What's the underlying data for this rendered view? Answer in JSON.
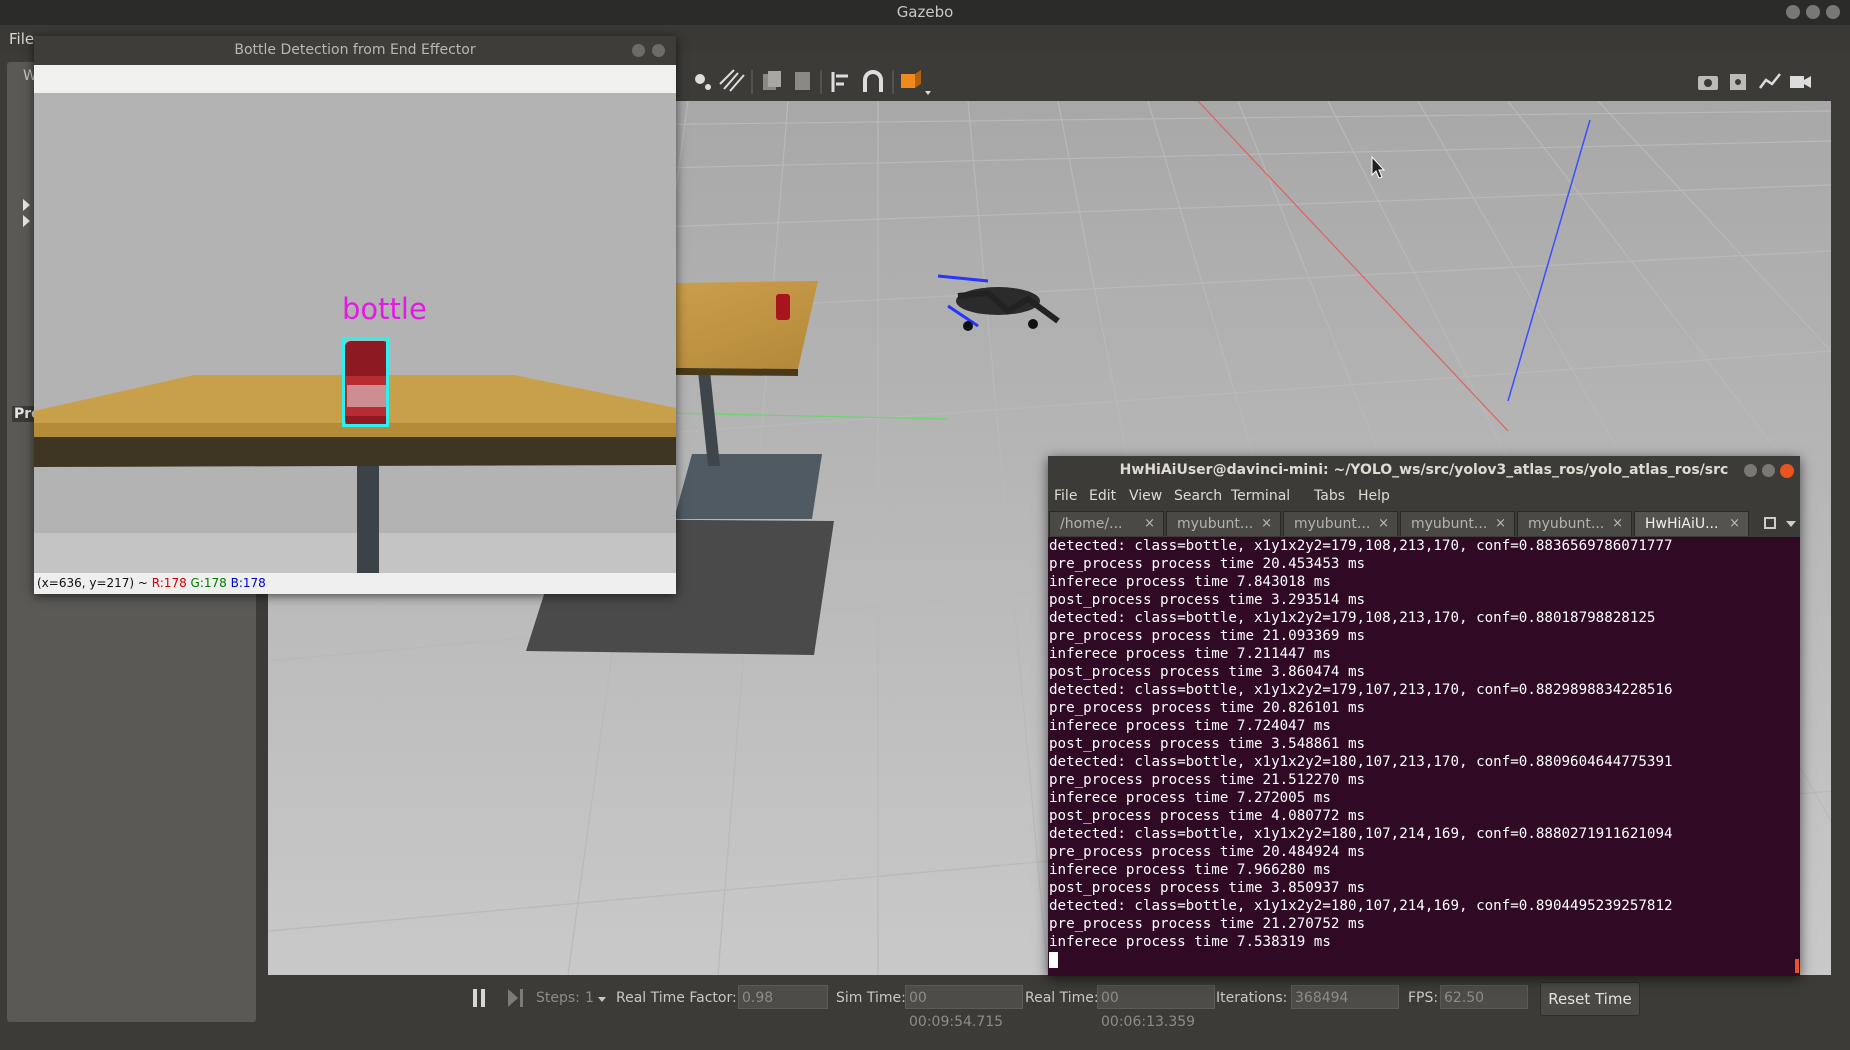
{
  "gazebo": {
    "title": "Gazebo",
    "menu_file": "File",
    "left_tab": "W",
    "left_label": "Pro",
    "bottom": {
      "steps_label": "Steps:",
      "steps_value": "1",
      "rtf_label": "Real Time Factor:",
      "rtf_value": "0.98",
      "sim_time_label": "Sim Time:",
      "sim_time_value": "00 00:09:54.715",
      "real_time_label": "Real Time:",
      "real_time_value": "00 00:06:13.359",
      "iterations_label": "Iterations:",
      "iterations_value": "368494",
      "fps_label": "FPS:",
      "fps_value": "62.50",
      "reset_label": "Reset Time"
    }
  },
  "bottle_window": {
    "title": "Bottle Detection from End Effector",
    "detection_label": "bottle",
    "status_coords": "(x=636, y=217) ~ ",
    "status_r": "R:178",
    "status_g": "G:178",
    "status_b": "B:178",
    "colors": {
      "label": "#e21be2",
      "box": "#2ef0f0"
    }
  },
  "terminal": {
    "title": "HwHiAiUser@davinci-mini: ~/YOLO_ws/src/yolov3_atlas_ros/yolo_atlas_ros/src",
    "menu": [
      "File",
      "Edit",
      "View",
      "Search",
      "Terminal",
      "Tabs",
      "Help"
    ],
    "tabs": [
      "/home/...",
      "myubunt...",
      "myubunt...",
      "myubunt...",
      "myubunt...",
      "HwHiAiU..."
    ],
    "lines": [
      "detected: class=bottle, x1y1x2y2=179,108,213,170, conf=0.8836569786071777",
      "pre_process process time 20.453453 ms",
      "inferece process time 7.843018 ms",
      "post_process process time 3.293514 ms",
      "detected: class=bottle, x1y1x2y2=179,108,213,170, conf=0.88018798828125",
      "pre_process process time 21.093369 ms",
      "inferece process time 7.211447 ms",
      "post_process process time 3.860474 ms",
      "detected: class=bottle, x1y1x2y2=179,107,213,170, conf=0.8829898834228516",
      "pre_process process time 20.826101 ms",
      "inferece process time 7.724047 ms",
      "post_process process time 3.548861 ms",
      "detected: class=bottle, x1y1x2y2=180,107,213,170, conf=0.8809604644775391",
      "pre_process process time 21.512270 ms",
      "inferece process time 7.272005 ms",
      "post_process process time 4.080772 ms",
      "detected: class=bottle, x1y1x2y2=180,107,214,169, conf=0.8880271911621094",
      "pre_process process time 20.484924 ms",
      "inferece process time 7.966280 ms",
      "post_process process time 3.850937 ms",
      "detected: class=bottle, x1y1x2y2=180,107,214,169, conf=0.8904495239257812",
      "pre_process process time 21.270752 ms",
      "inferece process time 7.538319 ms"
    ],
    "colors": {
      "background": "#300a24",
      "text": "#ffffff"
    }
  },
  "icons": [
    "pointer-arrow-icon",
    "camera-icon",
    "record-icon",
    "plot-icon",
    "video-icon",
    "pause-icon",
    "step-icon",
    "close-icon",
    "minimize-icon",
    "maximize-icon",
    "new-tab-icon",
    "tab-dropdown-icon"
  ]
}
